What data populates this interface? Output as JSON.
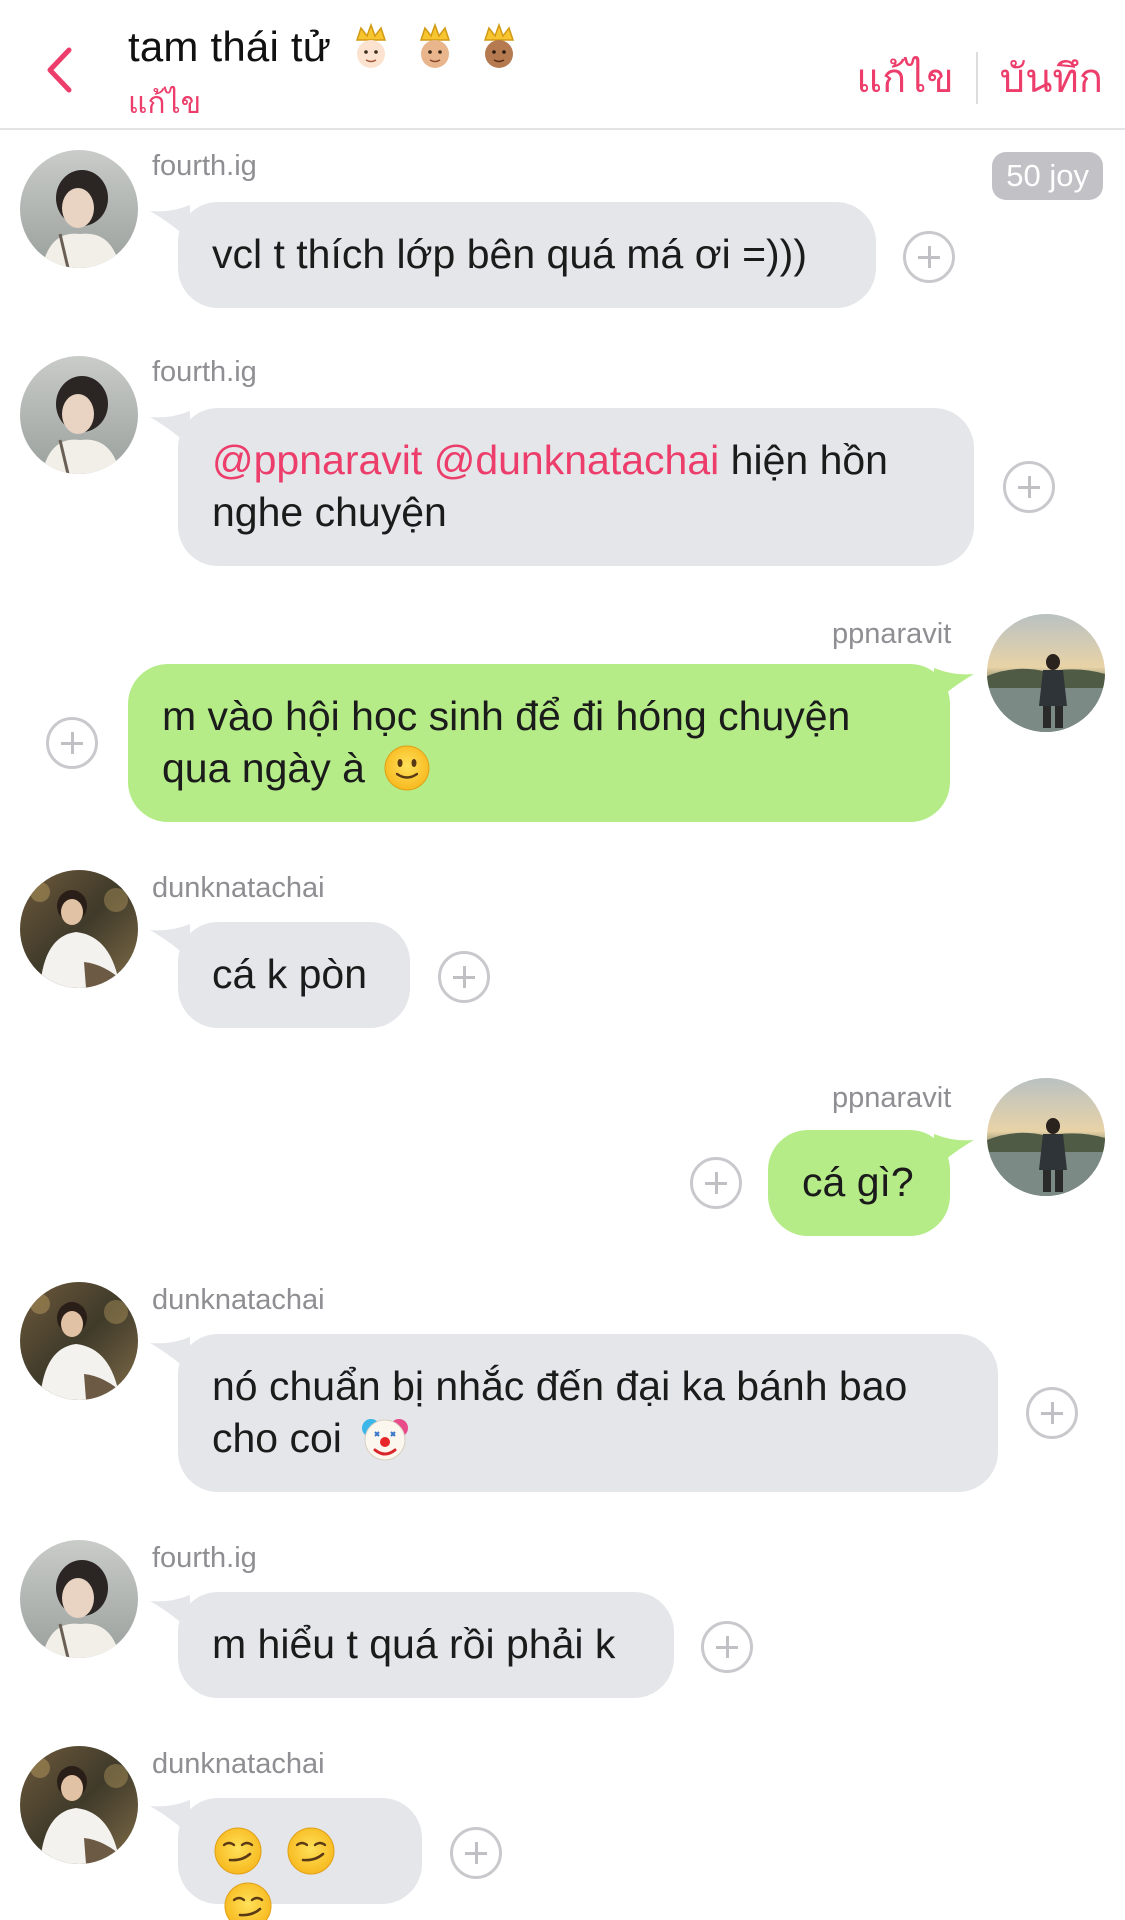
{
  "header": {
    "back_icon": "chevron-left-icon",
    "title": "tam thái tử",
    "crown_icons": [
      "prince-emoji-light",
      "prince-emoji-medium",
      "prince-emoji-dark"
    ],
    "subtitle_edit": "แก้ไข",
    "edit_label": "แก้ไข",
    "save_label": "บันทึก"
  },
  "colors": {
    "accent": "#ec3d6b",
    "incoming_bubble": "#e5e6ea",
    "outgoing_bubble": "#b5ec87",
    "muted_text": "#8e8e93"
  },
  "joy_badge": "50 joy",
  "messages": [
    {
      "sender": "fourth.ig",
      "direction": "incoming",
      "text": "vcl t thích lớp bên quá má ơi =)))"
    },
    {
      "sender": "fourth.ig",
      "direction": "incoming",
      "mention_1": "@ppnaravit",
      "mention_2": "@dunknatachai",
      "text_after": "hiện hồn",
      "text_line2": "nghe chuyện"
    },
    {
      "sender": "ppnaravit",
      "direction": "outgoing",
      "text_line1": "m vào hội học sinh để đi hóng chuyện",
      "text_line2": "qua ngày à",
      "emoji": "slightly-smiling-face"
    },
    {
      "sender": "dunknatachai",
      "direction": "incoming",
      "text": "cá k pòn"
    },
    {
      "sender": "ppnaravit",
      "direction": "outgoing",
      "text": "cá gì?"
    },
    {
      "sender": "dunknatachai",
      "direction": "incoming",
      "text_line1": "nó chuẩn bị nhắc đến đại ka bánh bao",
      "text_line2": "cho coi",
      "emoji": "clown-face"
    },
    {
      "sender": "fourth.ig",
      "direction": "incoming",
      "text": "m hiểu t quá rồi phải k"
    },
    {
      "sender": "dunknatachai",
      "direction": "incoming",
      "emoji": "smirking-face",
      "emoji_count": 3
    }
  ]
}
